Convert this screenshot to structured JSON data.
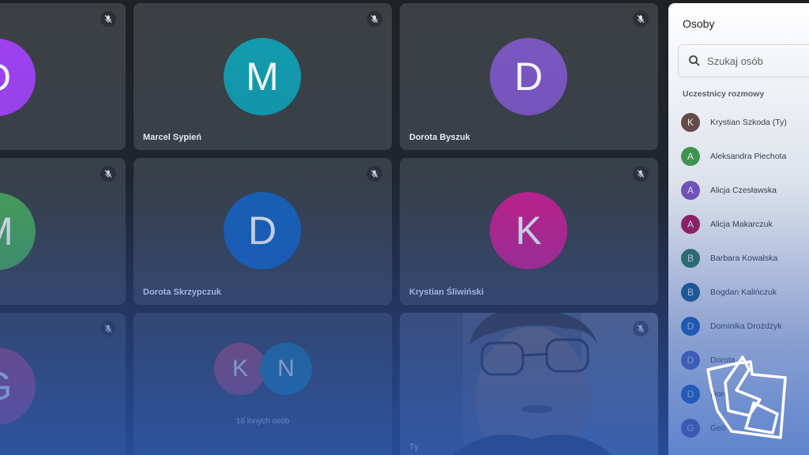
{
  "tiles": [
    {
      "letter": "D",
      "name": "",
      "color": "#a142f4"
    },
    {
      "letter": "M",
      "name": "Marcel Sypień",
      "color": "#129eaf"
    },
    {
      "letter": "D",
      "name": "Dorota Byszuk",
      "color": "#7e57c2"
    },
    {
      "letter": "M",
      "name": "",
      "color": "#4caf50"
    },
    {
      "letter": "D",
      "name": "Dorota Skrzypczuk",
      "color": "#1565c0"
    },
    {
      "letter": "K",
      "name": "Krystian Śliwiński",
      "color": "#d81b8c"
    },
    {
      "letter": "G",
      "name": "",
      "color": "#b3426a"
    }
  ],
  "others": {
    "a": "K",
    "b": "N",
    "label": "16 innych osób",
    "a_color": "#b5485a",
    "b_color": "#1a7d94"
  },
  "self_tile": {
    "name": "Ty"
  },
  "panel": {
    "title": "Osoby",
    "search_placeholder": "Szukaj osób",
    "section": "Uczestnicy rozmowy",
    "people": [
      {
        "letter": "K",
        "name": "Krystian Szkoda (Ty)",
        "color": "#6d4c41"
      },
      {
        "letter": "A",
        "name": "Aleksandra Piechota",
        "color": "#43a047"
      },
      {
        "letter": "A",
        "name": "Alicja Czesławska",
        "color": "#7e57c2"
      },
      {
        "letter": "A",
        "name": "Alicja Makarczuk",
        "color": "#ad1457"
      },
      {
        "letter": "B",
        "name": "Barbara Kowalska",
        "color": "#2e7d5b"
      },
      {
        "letter": "B",
        "name": "Bogdan Kalińczuk",
        "color": "#1a5e8a"
      },
      {
        "letter": "D",
        "name": "Dominika Drożdżyk",
        "color": "#1565c0"
      },
      {
        "letter": "D",
        "name": "Dorota",
        "color": "#5c6bc0"
      },
      {
        "letter": "D",
        "name": "Doro",
        "color": "#1e62c0"
      },
      {
        "letter": "G",
        "name": "Geo",
        "color": "#6d5b98"
      }
    ]
  }
}
